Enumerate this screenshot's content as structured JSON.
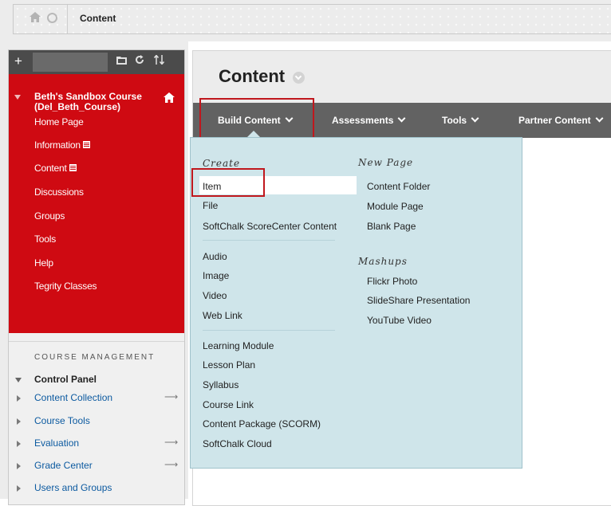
{
  "breadcrumb": {
    "label": "Content"
  },
  "left_panel": {
    "course_title": "Beth's Sandbox Course (Del_Beth_Course)",
    "nav_items": [
      {
        "label": "Home Page",
        "has_badge": false
      },
      {
        "label": "Information",
        "has_badge": true
      },
      {
        "label": "Content",
        "has_badge": true
      },
      {
        "label": "Discussions",
        "has_badge": false
      },
      {
        "label": "Groups",
        "has_badge": false
      },
      {
        "label": "Tools",
        "has_badge": false
      },
      {
        "label": "Help",
        "has_badge": false
      },
      {
        "label": "Tegrity Classes",
        "has_badge": false
      }
    ],
    "course_management": "COURSE MANAGEMENT",
    "control_panel": "Control Panel",
    "cp_items": [
      {
        "label": "Content Collection",
        "arrow": true
      },
      {
        "label": "Course Tools",
        "arrow": false
      },
      {
        "label": "Evaluation",
        "arrow": true
      },
      {
        "label": "Grade Center",
        "arrow": true
      },
      {
        "label": "Users and Groups",
        "arrow": false
      }
    ]
  },
  "content": {
    "title": "Content",
    "menu": {
      "build_content": "Build Content",
      "assessments": "Assessments",
      "tools": "Tools",
      "partner_content": "Partner Content"
    }
  },
  "dropdown": {
    "create_heading": "Create",
    "create_items": [
      "Item",
      "File",
      "SoftChalk ScoreCenter Content"
    ],
    "media_items": [
      "Audio",
      "Image",
      "Video",
      "Web Link"
    ],
    "module_items": [
      "Learning Module",
      "Lesson Plan",
      "Syllabus",
      "Course Link",
      "Content Package (SCORM)",
      "SoftChalk Cloud"
    ],
    "new_page_heading": "New Page",
    "new_page_items": [
      "Content Folder",
      "Module Page",
      "Blank Page"
    ],
    "mashups_heading": "Mashups",
    "mashups_items": [
      "Flickr Photo",
      "SlideShare Presentation",
      "YouTube Video"
    ]
  },
  "colors": {
    "course_red": "#cf0a12",
    "menu_gray": "#626262",
    "dropdown_bg": "#cfe5ea",
    "highlight_border": "#c0171d"
  }
}
